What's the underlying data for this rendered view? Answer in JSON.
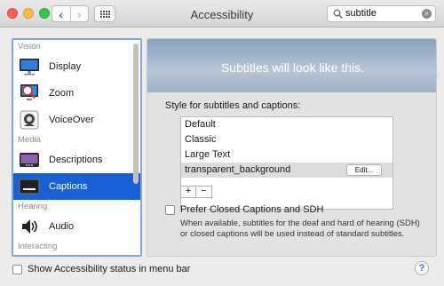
{
  "window": {
    "title": "Accessibility"
  },
  "toolbar": {
    "back_glyph": "‹",
    "forward_glyph": "›",
    "search": {
      "value": "subtitle",
      "clear_glyph": "×"
    }
  },
  "sidebar": {
    "sections": [
      {
        "label": "Vision"
      },
      {
        "label": "Media"
      },
      {
        "label": "Hearing"
      },
      {
        "label": "Interacting"
      }
    ],
    "items": [
      {
        "label": "Display",
        "icon": "display-icon"
      },
      {
        "label": "Zoom",
        "icon": "zoom-icon"
      },
      {
        "label": "VoiceOver",
        "icon": "voiceover-icon"
      },
      {
        "label": "Descriptions",
        "icon": "descriptions-icon"
      },
      {
        "label": "Captions",
        "icon": "captions-icon",
        "selected": true
      },
      {
        "label": "Audio",
        "icon": "audio-icon"
      }
    ]
  },
  "captions": {
    "preview_text": "Subtitles will look like this.",
    "style_label": "Style for subtitles and captions:",
    "styles": [
      {
        "label": "Default"
      },
      {
        "label": "Classic"
      },
      {
        "label": "Large Text"
      },
      {
        "label": "transparent_background",
        "selected": true
      }
    ],
    "edit_label": "Edit...",
    "add_label": "+",
    "remove_label": "−",
    "prefer_label": "Prefer Closed Captions and SDH",
    "prefer_checked": false,
    "prefer_description": "When available, subtitles for the deaf and hard of hearing (SDH) or closed captions will be used instead of standard subtitles."
  },
  "footer": {
    "status_label": "Show Accessibility status in menu bar",
    "status_checked": false,
    "help_label": "?"
  },
  "colors": {
    "selection": "#1860d6",
    "focus_ring": "#7fa7e3",
    "close": "#fc605c",
    "minimize": "#fdbc40",
    "zoom": "#34c84a"
  }
}
